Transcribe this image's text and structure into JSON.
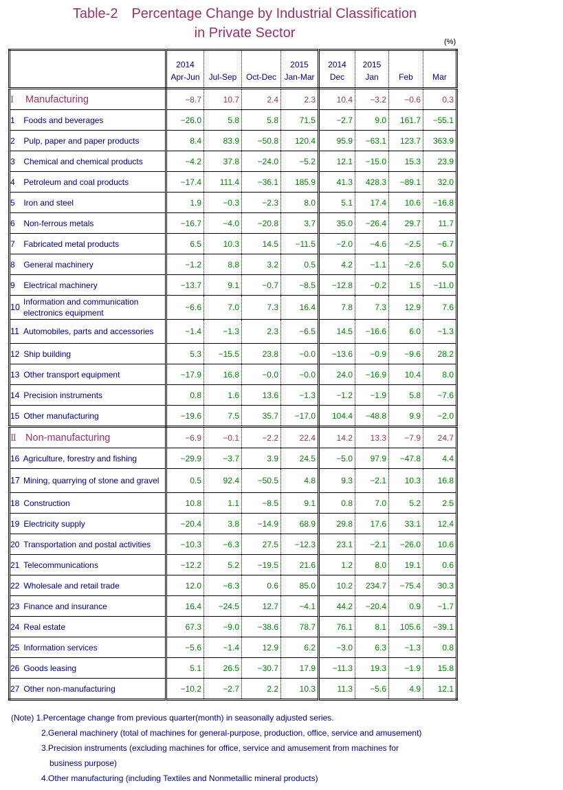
{
  "title": {
    "line1": "Table-2　Percentage Change by Industrial Classification",
    "line2": "in Private Sector"
  },
  "unit": "(%)",
  "columns": [
    {
      "year": "2014",
      "period": "Apr-Jun"
    },
    {
      "year": "",
      "period": "Jul-Sep"
    },
    {
      "year": "",
      "period": "Oct-Dec"
    },
    {
      "year": "2015",
      "period": "Jan-Mar"
    },
    {
      "year": "2014",
      "period": "Dec"
    },
    {
      "year": "2015",
      "period": "Jan"
    },
    {
      "year": "",
      "period": "Feb"
    },
    {
      "year": "",
      "period": "Mar"
    }
  ],
  "rows": [
    {
      "type": "section",
      "code": "Ⅰ",
      "label": "Manufacturing",
      "values": [
        "-8.7",
        "10.7",
        "2.4",
        "2.3",
        "10.4",
        "-3.2",
        "-0.6",
        "0.3"
      ]
    },
    {
      "type": "item",
      "code": "1",
      "label": "Foods and beverages",
      "values": [
        "-26.0",
        "5.8",
        "5.8",
        "71.5",
        "-2.7",
        "9.0",
        "161.7",
        "-55.1"
      ]
    },
    {
      "type": "item",
      "code": "2",
      "label": "Pulp, paper and paper products",
      "values": [
        "8.4",
        "83.9",
        "-50.8",
        "120.4",
        "95.9",
        "-63.1",
        "123.7",
        "363.9"
      ]
    },
    {
      "type": "item",
      "code": "3",
      "label": "Chemical and chemical products",
      "values": [
        "-4.2",
        "37.8",
        "-24.0",
        "-5.2",
        "12.1",
        "-15.0",
        "15.3",
        "23.9"
      ]
    },
    {
      "type": "item",
      "code": "4",
      "label": "Petroleum and coal products",
      "values": [
        "-17.4",
        "111.4",
        "-36.1",
        "185.9",
        "41.3",
        "428.3",
        "-89.1",
        "32.0"
      ]
    },
    {
      "type": "item",
      "code": "5",
      "label": "Iron and steel",
      "values": [
        "1.9",
        "-0.3",
        "-2.3",
        "8.0",
        "5.1",
        "17.4",
        "10.6",
        "-16.8"
      ]
    },
    {
      "type": "item",
      "code": "6",
      "label": "Non-ferrous metals",
      "values": [
        "-16.7",
        "-4.0",
        "-20.8",
        "3.7",
        "35.0",
        "-26.4",
        "29.7",
        "11.7"
      ]
    },
    {
      "type": "item",
      "code": "7",
      "label": "Fabricated metal products",
      "values": [
        "6.5",
        "10.3",
        "14.5",
        "-11.5",
        "-2.0",
        "-4.6",
        "-2.5",
        "-6.7"
      ]
    },
    {
      "type": "item",
      "code": "8",
      "label": "General machinery",
      "values": [
        "-1.2",
        "8.8",
        "3.2",
        "0.5",
        "4.2",
        "-1.1",
        "-2.6",
        "5.0"
      ]
    },
    {
      "type": "item",
      "code": "9",
      "label": "Electrical machinery",
      "values": [
        "-13.7",
        "9.1",
        "-0.7",
        "-8.5",
        "-12.8",
        "-0.2",
        "1.5",
        "-11.0"
      ]
    },
    {
      "type": "item2",
      "code": "10",
      "label": "Information and communication electronics equipment",
      "values": [
        "-6.6",
        "7.0",
        "7.3",
        "16.4",
        "7.8",
        "7.3",
        "12.9",
        "7.6"
      ]
    },
    {
      "type": "item2",
      "code": "11",
      "label": "Automobiles, parts and accessories",
      "values": [
        "-1.4",
        "-1.3",
        "2.3",
        "-6.5",
        "14.5",
        "-16.6",
        "6.0",
        "-1.3"
      ]
    },
    {
      "type": "item",
      "code": "12",
      "label": "Ship building",
      "values": [
        "5.3",
        "-15.5",
        "23.8",
        "-0.0",
        "-13.6",
        "-0.9",
        "-9.6",
        "28.2"
      ]
    },
    {
      "type": "item",
      "code": "13",
      "label": "Other transport equipment",
      "values": [
        "-17.9",
        "16.8",
        "-0.0",
        "-0.0",
        "24.0",
        "-16.9",
        "10.4",
        "8.0"
      ]
    },
    {
      "type": "item",
      "code": "14",
      "label": "Precision instruments",
      "values": [
        "0.8",
        "1.6",
        "13.6",
        "-1.3",
        "-1.2",
        "-1.9",
        "5.8",
        "-7.6"
      ]
    },
    {
      "type": "item",
      "code": "15",
      "label": "Other manufacturing",
      "values": [
        "-19.6",
        "7.5",
        "35.7",
        "-17.0",
        "104.4",
        "-48.8",
        "9.9",
        "-2.0"
      ]
    },
    {
      "type": "section",
      "code": "Ⅱ",
      "label": "Non-manufacturing",
      "values": [
        "-6.9",
        "-0.1",
        "-2.2",
        "22.4",
        "14.2",
        "13.3",
        "-7.9",
        "24.7"
      ]
    },
    {
      "type": "item",
      "code": "16",
      "label": "Agriculture, forestry and fishing",
      "values": [
        "-29.9",
        "-3.7",
        "3.9",
        "24.5",
        "-5.0",
        "97.9",
        "-47.8",
        "4.4"
      ]
    },
    {
      "type": "item2",
      "code": "17",
      "label": "Mining, quarrying of stone and gravel",
      "values": [
        "0.5",
        "92.4",
        "-50.5",
        "4.8",
        "9.3",
        "-2.1",
        "10.3",
        "16.8"
      ]
    },
    {
      "type": "item",
      "code": "18",
      "label": "Construction",
      "values": [
        "10.8",
        "1.1",
        "-8.5",
        "9.1",
        "0.8",
        "7.0",
        "5.2",
        "2.5"
      ]
    },
    {
      "type": "item",
      "code": "19",
      "label": "Electricity supply",
      "values": [
        "-20.4",
        "3.8",
        "-14.9",
        "68.9",
        "29.8",
        "17.6",
        "33.1",
        "12.4"
      ]
    },
    {
      "type": "item",
      "code": "20",
      "label": "Transportation and postal activities",
      "values": [
        "-10.3",
        "-6.3",
        "27.5",
        "-12.3",
        "23.1",
        "-2.1",
        "-26.0",
        "10.6"
      ]
    },
    {
      "type": "item",
      "code": "21",
      "label": "Telecommunications",
      "values": [
        "-12.2",
        "5.2",
        "-19.5",
        "21.6",
        "1.2",
        "8.0",
        "19.1",
        "0.6"
      ]
    },
    {
      "type": "item",
      "code": "22",
      "label": "Wholesale and retail trade",
      "values": [
        "12.0",
        "-6.3",
        "0.6",
        "85.0",
        "10.2",
        "234.7",
        "-75.4",
        "30.3"
      ]
    },
    {
      "type": "item",
      "code": "23",
      "label": "Finance and insurance",
      "values": [
        "16.4",
        "-24.5",
        "12.7",
        "-4.1",
        "44.2",
        "-20.4",
        "0.9",
        "-1.7"
      ]
    },
    {
      "type": "item",
      "code": "24",
      "label": "Real estate",
      "values": [
        "67.3",
        "-9.0",
        "-38.6",
        "78.7",
        "76.1",
        "8.1",
        "105.6",
        "-39.1"
      ]
    },
    {
      "type": "item",
      "code": "25",
      "label": "Information services",
      "values": [
        "-5.6",
        "-1.4",
        "12.9",
        "6.2",
        "-3.0",
        "6.3",
        "-1.3",
        "0.8"
      ]
    },
    {
      "type": "item",
      "code": "26",
      "label": "Goods leasing",
      "values": [
        "5.1",
        "26.5",
        "-30.7",
        "17.9",
        "-11.3",
        "19.3",
        "-1.9",
        "15.8"
      ]
    },
    {
      "type": "item",
      "code": "27",
      "label": "Other non-manufacturing",
      "values": [
        "-10.2",
        "-2.7",
        "2.2",
        "10.3",
        "11.3",
        "-5.6",
        "4.9",
        "12.1"
      ]
    }
  ],
  "notes": [
    "(Note) 1.Percentage change from previous quarter(month) in seasonally adjusted series.",
    "2.General machinery (total of machines for general-purpose, production, office, service and amusement)",
    "3.Precision instruments (excluding machines for office, service and amusement from machines for",
    "business purpose)",
    "4.Other manufacturing (including Textiles and Nonmetallic mineral products)"
  ],
  "colors": {
    "title": "#993366",
    "section": "#993366",
    "label": "#000080",
    "value": "#008000"
  }
}
